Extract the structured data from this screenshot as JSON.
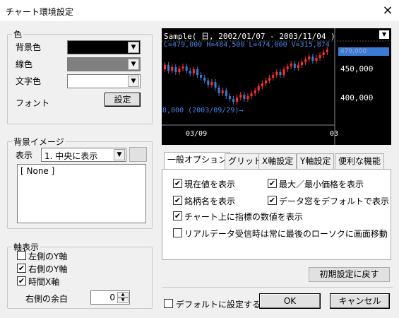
{
  "window": {
    "title": "チャート環境設定",
    "close_icon": "×"
  },
  "color_group": {
    "legend": "色",
    "background_label": "背景色",
    "line_label": "線色",
    "text_label": "文字色",
    "font_label": "フォント",
    "font_button": "設定",
    "background_color": "#000000",
    "line_color": "#808080",
    "text_color": "#ffffff"
  },
  "bg_image_group": {
    "legend": "背景イメージ",
    "display_label": "表示",
    "display_value": "1. 中央に表示",
    "list_items": [
      "[ None ]"
    ]
  },
  "axis_group": {
    "legend": "軸表示",
    "left_y": {
      "label": "左側のY軸",
      "checked": false
    },
    "right_y": {
      "label": "右側のY軸",
      "checked": true
    },
    "time_x": {
      "label": "時間X軸",
      "checked": true
    },
    "margin_label": "右側の余白",
    "margin_value": "0"
  },
  "preview": {
    "header": "Sample( 日, 2002/01/07 - 2003/11/04 )",
    "ohlc": "C=479,000 H=484,500 L=474,000 V=315,874",
    "current_price": "479,000",
    "price_450": "450,000",
    "price_400": "400,000",
    "low_annotation": "8,000 (2003/09/29)→",
    "x_tick_1": "03/09",
    "x_tick_2": "03",
    "up_color": "#ff3030",
    "down_color": "#3a7bd5"
  },
  "tabs": [
    "一般オプション",
    "グリッド",
    "X軸設定",
    "Y軸設定",
    "便利な機能"
  ],
  "general_options": [
    {
      "label": "現在値を表示",
      "checked": true
    },
    {
      "label": "最大／最小価格を表示",
      "checked": true
    },
    {
      "label": "銘柄名を表示",
      "checked": true
    },
    {
      "label": "データ窓をデフォルトで表示",
      "checked": true
    },
    {
      "label": "チャート上に指標の数値を表示",
      "checked": true
    },
    {
      "label": "リアルデータ受信時は常に最後のローソクに画面移動",
      "checked": false
    }
  ],
  "buttons": {
    "reset": "初期設定に戻す",
    "default_label": "デフォルトに設定する",
    "ok": "OK",
    "cancel": "キャンセル"
  },
  "check_mark": "✔"
}
